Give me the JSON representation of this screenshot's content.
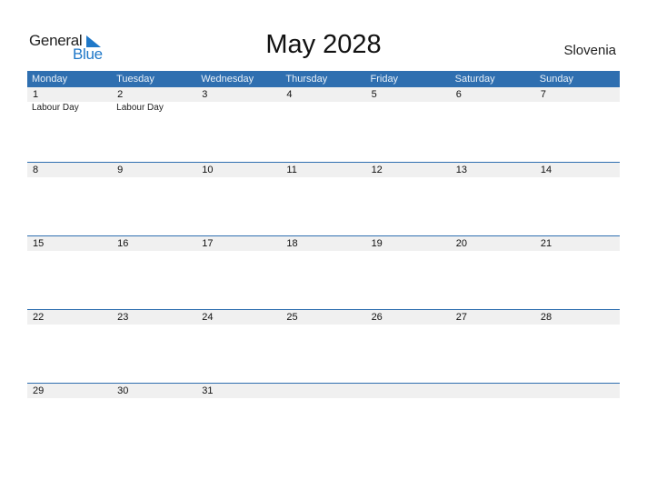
{
  "logo": {
    "word1": "General",
    "word2": "Blue"
  },
  "title": "May 2028",
  "country": "Slovenia",
  "colors": {
    "header_bg": "#2f6fb0",
    "accent": "#1f78c8",
    "day_strip": "#f0f0f0"
  },
  "weekdays": [
    "Monday",
    "Tuesday",
    "Wednesday",
    "Thursday",
    "Friday",
    "Saturday",
    "Sunday"
  ],
  "weeks": [
    [
      {
        "day": "1",
        "holiday": "Labour Day"
      },
      {
        "day": "2",
        "holiday": "Labour Day"
      },
      {
        "day": "3",
        "holiday": ""
      },
      {
        "day": "4",
        "holiday": ""
      },
      {
        "day": "5",
        "holiday": ""
      },
      {
        "day": "6",
        "holiday": ""
      },
      {
        "day": "7",
        "holiday": ""
      }
    ],
    [
      {
        "day": "8",
        "holiday": ""
      },
      {
        "day": "9",
        "holiday": ""
      },
      {
        "day": "10",
        "holiday": ""
      },
      {
        "day": "11",
        "holiday": ""
      },
      {
        "day": "12",
        "holiday": ""
      },
      {
        "day": "13",
        "holiday": ""
      },
      {
        "day": "14",
        "holiday": ""
      }
    ],
    [
      {
        "day": "15",
        "holiday": ""
      },
      {
        "day": "16",
        "holiday": ""
      },
      {
        "day": "17",
        "holiday": ""
      },
      {
        "day": "18",
        "holiday": ""
      },
      {
        "day": "19",
        "holiday": ""
      },
      {
        "day": "20",
        "holiday": ""
      },
      {
        "day": "21",
        "holiday": ""
      }
    ],
    [
      {
        "day": "22",
        "holiday": ""
      },
      {
        "day": "23",
        "holiday": ""
      },
      {
        "day": "24",
        "holiday": ""
      },
      {
        "day": "25",
        "holiday": ""
      },
      {
        "day": "26",
        "holiday": ""
      },
      {
        "day": "27",
        "holiday": ""
      },
      {
        "day": "28",
        "holiday": ""
      }
    ],
    [
      {
        "day": "29",
        "holiday": ""
      },
      {
        "day": "30",
        "holiday": ""
      },
      {
        "day": "31",
        "holiday": ""
      },
      {
        "day": "",
        "holiday": ""
      },
      {
        "day": "",
        "holiday": ""
      },
      {
        "day": "",
        "holiday": ""
      },
      {
        "day": "",
        "holiday": ""
      }
    ]
  ]
}
